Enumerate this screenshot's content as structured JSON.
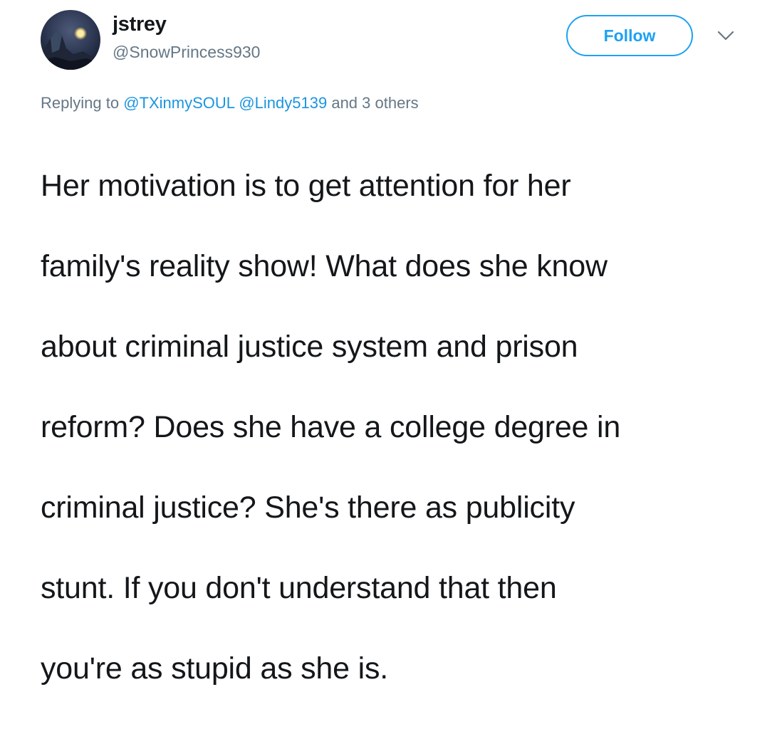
{
  "tweet": {
    "user": {
      "display_name": "jstrey",
      "handle": "@SnowPrincess930",
      "avatar_icon": "moon-over-mountain-avatar"
    },
    "follow_label": "Follow",
    "menu_icon": "chevron-down-icon",
    "reply": {
      "prefix": "Replying to",
      "mentions": [
        "@TXinmySOUL",
        "@Lindy5139"
      ],
      "suffix": "and 3 others"
    },
    "lines": [
      "Her motivation is to get attention for her",
      "family's reality show! What does she know",
      "about criminal justice system and prison",
      "reform? Does she have a college degree in",
      "criminal justice? She's there as publicity",
      "stunt. If you don't understand that then",
      "you're as stupid as she is."
    ]
  },
  "colors": {
    "accent": "#1da1f2",
    "mention": "#1b95e0",
    "secondary_text": "#657786",
    "primary_text": "#14171a"
  }
}
